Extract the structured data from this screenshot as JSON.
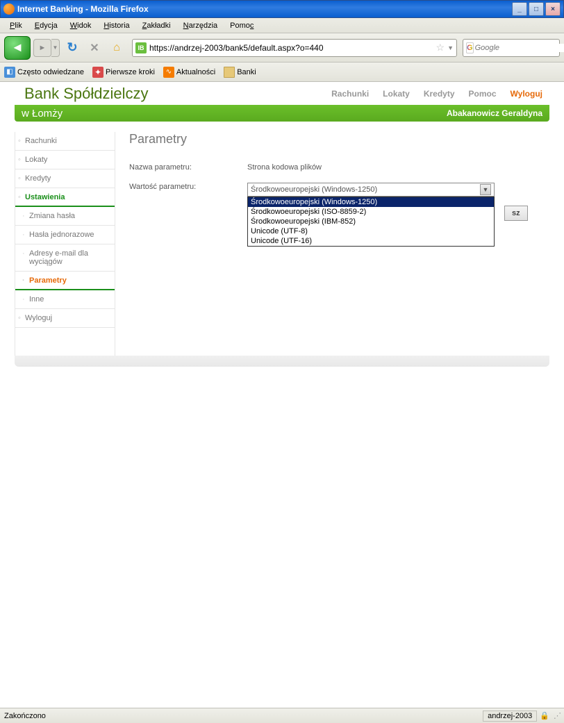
{
  "window": {
    "title": "Internet Banking - Mozilla Firefox"
  },
  "menu": {
    "file": "Plik",
    "edit": "Edycja",
    "view": "Widok",
    "history": "Historia",
    "bookmarks": "Zakładki",
    "tools": "Narzędzia",
    "help": "Pomoc"
  },
  "url": "https://andrzej-2003/bank5/default.aspx?o=440",
  "search_placeholder": "Google",
  "bookmarks": {
    "visited": "Często odwiedzane",
    "firststeps": "Pierwsze kroki",
    "news": "Aktualności",
    "banks": "Banki"
  },
  "bank": {
    "name": "Bank Spółdzielczy",
    "location": "w Łomży",
    "user": "Abakanowicz Geraldyna"
  },
  "topnav": {
    "accounts": "Rachunki",
    "deposits": "Lokaty",
    "credits": "Kredyty",
    "help": "Pomoc",
    "logout": "Wyloguj"
  },
  "sidebar": {
    "accounts": "Rachunki",
    "deposits": "Lokaty",
    "credits": "Kredyty",
    "settings": "Ustawienia",
    "changepw": "Zmiana hasła",
    "otp": "Hasła jednorazowe",
    "email": "Adresy e-mail dla wyciągów",
    "params": "Parametry",
    "other": "Inne",
    "logout": "Wyloguj"
  },
  "content": {
    "heading": "Parametry",
    "name_label": "Nazwa parametru:",
    "name_value": "Strona kodowa plików",
    "value_label": "Wartość parametru:",
    "selected": "Środkowoeuropejski (Windows-1250)",
    "options": [
      "Środkowoeuropejski (Windows-1250)",
      "Środkowoeuropejski (ISO-8859-2)",
      "Środkowoeuropejski (IBM-852)",
      "Unicode (UTF-8)",
      "Unicode (UTF-16)"
    ],
    "button_suffix": "sz"
  },
  "status": {
    "done": "Zakończono",
    "host": "andrzej-2003"
  }
}
